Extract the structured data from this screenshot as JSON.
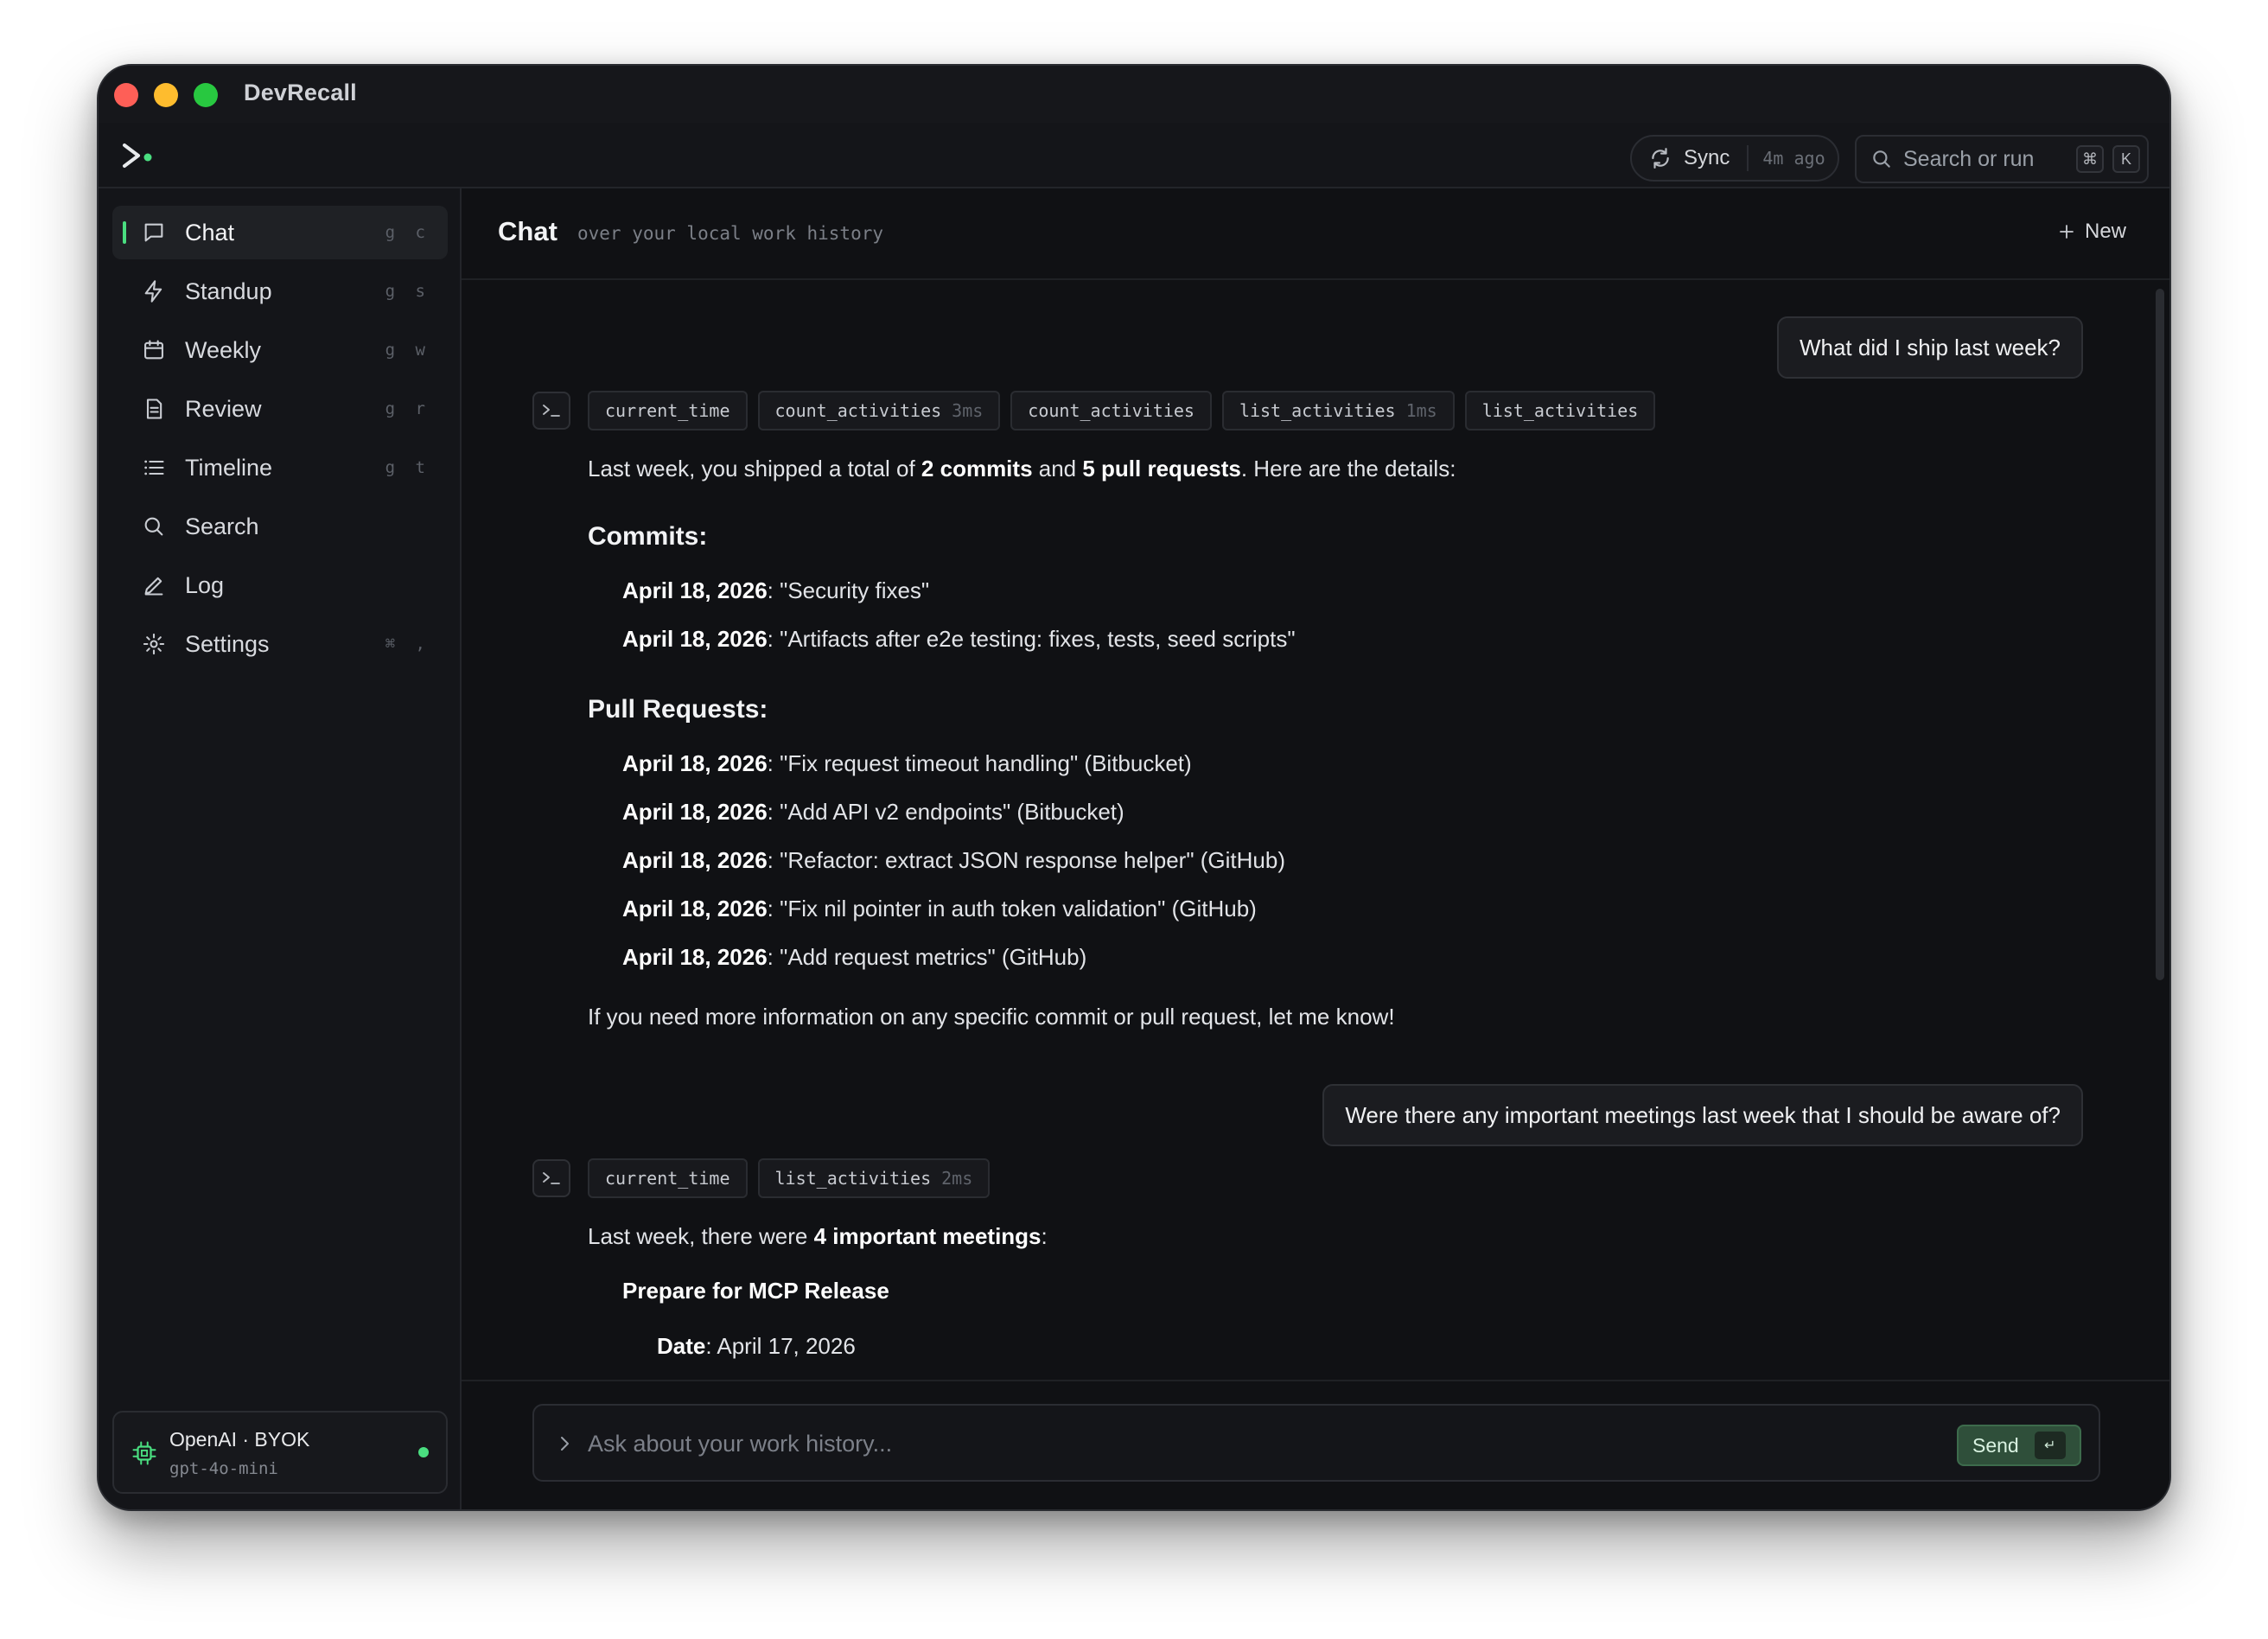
{
  "window": {
    "app_title": "DevRecall",
    "colors": {
      "accent": "#4ade80",
      "background": "#111216",
      "send": "#2f4f3a"
    }
  },
  "toolbar": {
    "logo_icon": "prompt-logo-icon",
    "sync_label": "Sync",
    "sync_time": "4m ago",
    "search_placeholder": "Search or run",
    "shortcut_mod": "⌘",
    "shortcut_key": "K"
  },
  "sidebar": {
    "items": [
      {
        "label": "Chat",
        "key": "g c",
        "icon": "chat-bubble-icon",
        "active": true
      },
      {
        "label": "Standup",
        "key": "g s",
        "icon": "lightning-icon"
      },
      {
        "label": "Weekly",
        "key": "g w",
        "icon": "calendar-icon"
      },
      {
        "label": "Review",
        "key": "g r",
        "icon": "document-icon"
      },
      {
        "label": "Timeline",
        "key": "g t",
        "icon": "list-icon"
      },
      {
        "label": "Search",
        "key": "",
        "icon": "search-icon"
      },
      {
        "label": "Log",
        "key": "",
        "icon": "pencil-icon"
      },
      {
        "label": "Settings",
        "key": "⌘ ,",
        "icon": "gear-icon"
      }
    ],
    "model": {
      "provider": "OpenAI · BYOK",
      "name": "gpt-4o-mini",
      "icon": "chip-icon"
    }
  },
  "main": {
    "title": "Chat",
    "subtitle": "over your local work history",
    "new_label": "New"
  },
  "conversation": {
    "user_message_1": "What did I ship last week?",
    "tools_1": [
      {
        "name": "current_time",
        "duration": ""
      },
      {
        "name": "count_activities",
        "duration": "3ms"
      },
      {
        "name": "count_activities",
        "duration": ""
      },
      {
        "name": "list_activities",
        "duration": "1ms"
      },
      {
        "name": "list_activities",
        "duration": ""
      }
    ],
    "reply_1": {
      "intro_a": "Last week, you shipped a total of ",
      "intro_b": "2 commits",
      "intro_c": " and ",
      "intro_d": "5 pull requests",
      "intro_e": ". Here are the details:",
      "commits_heading": "Commits:",
      "commits": [
        {
          "date": "April 18, 2026",
          "text": ": \"Security fixes\""
        },
        {
          "date": "April 18, 2026",
          "text": ": \"Artifacts after e2e testing: fixes, tests, seed scripts\""
        }
      ],
      "prs_heading": "Pull Requests:",
      "prs": [
        {
          "date": "April 18, 2026",
          "text": ": \"Fix request timeout handling\" (Bitbucket)"
        },
        {
          "date": "April 18, 2026",
          "text": ": \"Add API v2 endpoints\" (Bitbucket)"
        },
        {
          "date": "April 18, 2026",
          "text": ": \"Refactor: extract JSON response helper\" (GitHub)"
        },
        {
          "date": "April 18, 2026",
          "text": ": \"Fix nil pointer in auth token validation\" (GitHub)"
        },
        {
          "date": "April 18, 2026",
          "text": ": \"Add request metrics\" (GitHub)"
        }
      ],
      "outro": "If you need more information on any specific commit or pull request, let me know!"
    },
    "user_message_2": "Were there any important meetings last week that I should be aware of?",
    "tools_2": [
      {
        "name": "current_time",
        "duration": ""
      },
      {
        "name": "list_activities",
        "duration": "2ms"
      }
    ],
    "reply_2": {
      "intro_a": "Last week, there were ",
      "intro_b": "4 important meetings",
      "intro_c": ":",
      "meeting_title": "Prepare for MCP Release",
      "date_label": "Date",
      "date_value": ": April 17, 2026"
    }
  },
  "composer": {
    "placeholder": "Ask about your work history...",
    "send_label": "Send",
    "enter_glyph": "↵"
  }
}
